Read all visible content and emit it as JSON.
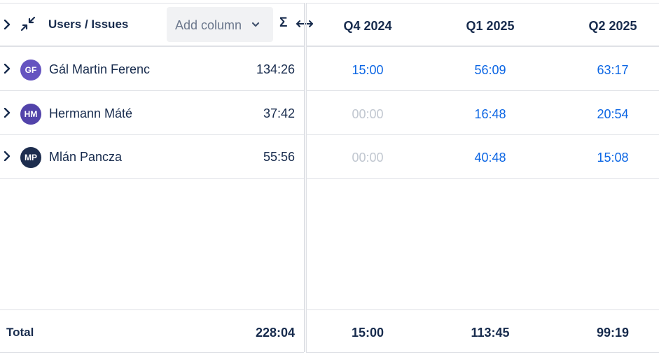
{
  "header": {
    "title": "Users / Issues",
    "add_column_placeholder": "Add column",
    "sigma_label": "Σ",
    "quarters": [
      "Q4 2024",
      "Q1 2025",
      "Q2 2025"
    ]
  },
  "rows": [
    {
      "initials": "GF",
      "avatar_color": "#6554c0",
      "name": "Gál Martin Ferenc",
      "total": "134:26",
      "values": [
        "15:00",
        "56:09",
        "63:17"
      ]
    },
    {
      "initials": "HM",
      "avatar_color": "#5243aa",
      "name": "Hermann Máté",
      "total": "37:42",
      "values": [
        "00:00",
        "16:48",
        "20:54"
      ]
    },
    {
      "initials": "MP",
      "avatar_color": "#1d2d4e",
      "name": "Mlán Pancza",
      "total": "55:56",
      "values": [
        "00:00",
        "40:48",
        "15:08"
      ]
    }
  ],
  "totals": {
    "label": "Total",
    "grand_total": "228:04",
    "values": [
      "15:00",
      "113:45",
      "99:19"
    ]
  },
  "colors": {
    "link": "#0c66e4",
    "muted": "#c1c7d0",
    "text": "#172b4d"
  },
  "icons": {
    "expand": "chevron-right-icon",
    "collapse_all": "collapse-arrows-icon",
    "dropdown": "chevron-down-icon",
    "resize": "horizontal-resize-icon"
  }
}
